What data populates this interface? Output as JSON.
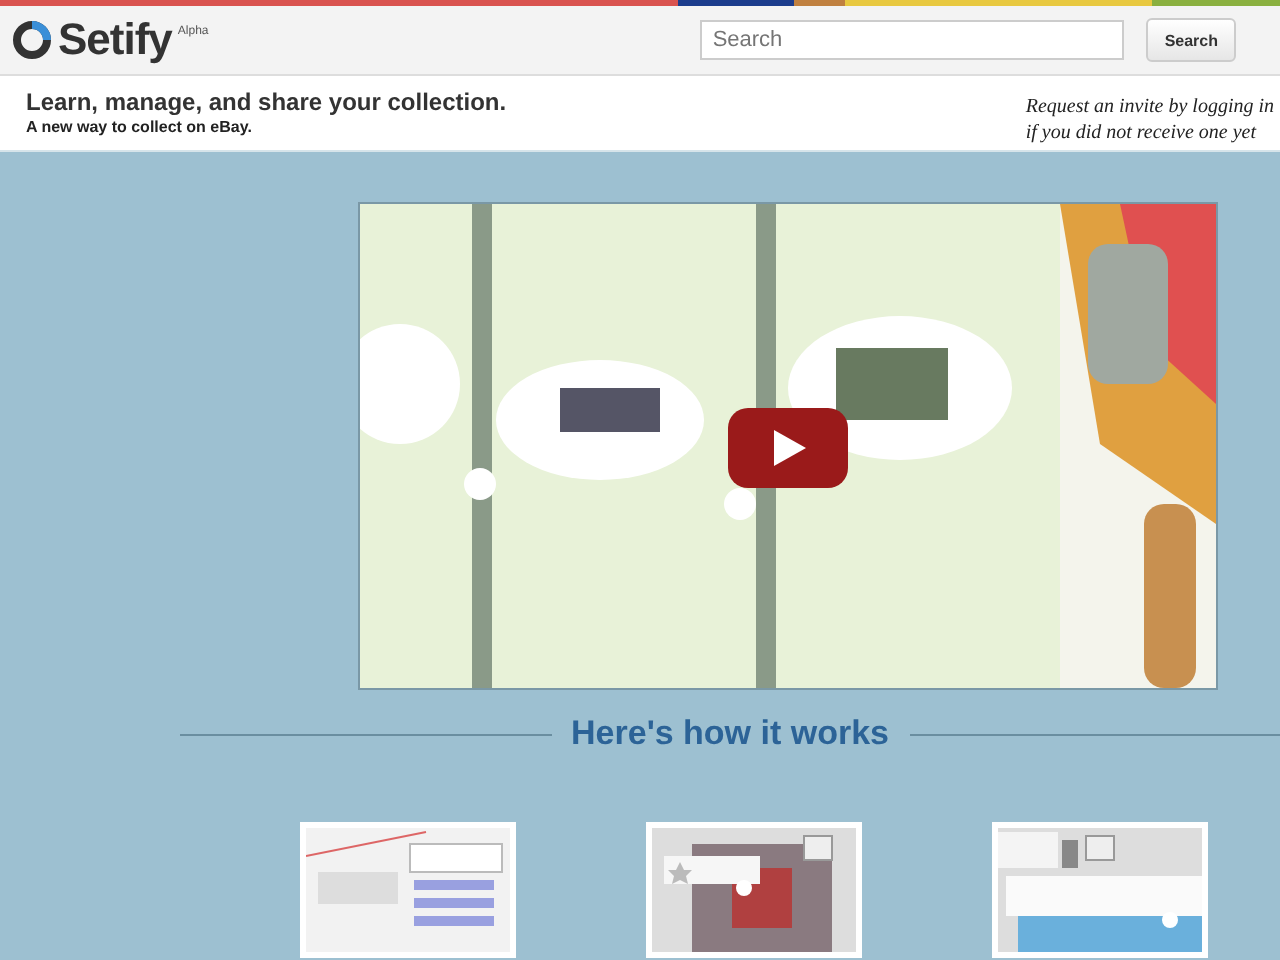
{
  "header": {
    "logo": "Setify",
    "badge": "Alpha",
    "search": {
      "placeholder": "Search"
    },
    "search_button": "Search"
  },
  "tagline": {
    "title": "Learn, manage, and share your collection.",
    "subtitle": "A new way to collect on eBay.",
    "invite_lines": [
      "Request an invite by logging in",
      "if you did not receive one yet"
    ]
  },
  "how_it_works": {
    "heading": "Here's how it works"
  }
}
